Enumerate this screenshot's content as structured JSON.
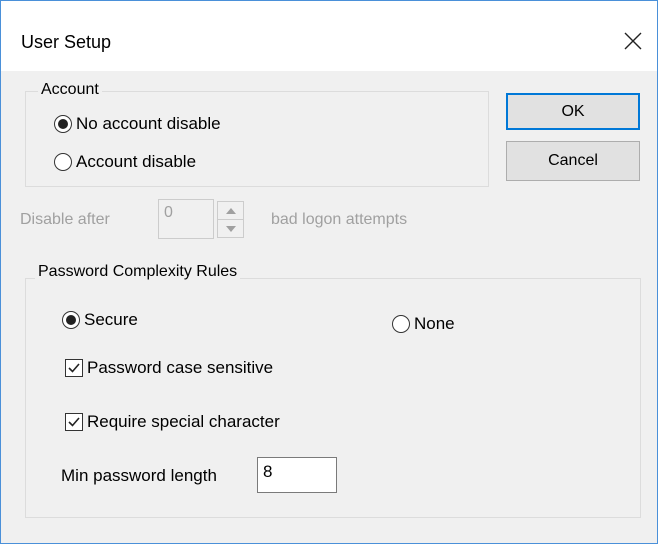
{
  "window": {
    "title": "User Setup",
    "close_icon": "close-icon"
  },
  "account_group": {
    "title": "Account",
    "options": [
      {
        "label": "No account disable",
        "selected": true
      },
      {
        "label": "Account disable",
        "selected": false
      }
    ]
  },
  "buttons": {
    "ok_label": "OK",
    "cancel_label": "Cancel"
  },
  "lockout": {
    "prefix": "Disable after",
    "value": "0",
    "suffix": "bad logon attempts",
    "enabled": false
  },
  "password_group": {
    "title": "Password Complexity Rules",
    "complexity_options": [
      {
        "label": "Secure",
        "selected": true
      },
      {
        "label": "None",
        "selected": false
      }
    ],
    "case_sensitive": {
      "label": "Password case sensitive",
      "checked": true
    },
    "special_char": {
      "label": "Require special character",
      "checked": true
    },
    "min_length": {
      "label": "Min password length",
      "value": "8"
    }
  },
  "colors": {
    "dialog_background": "#f0f0f0",
    "accent": "#0078d7",
    "disabled_text": "#a0a0a0"
  }
}
